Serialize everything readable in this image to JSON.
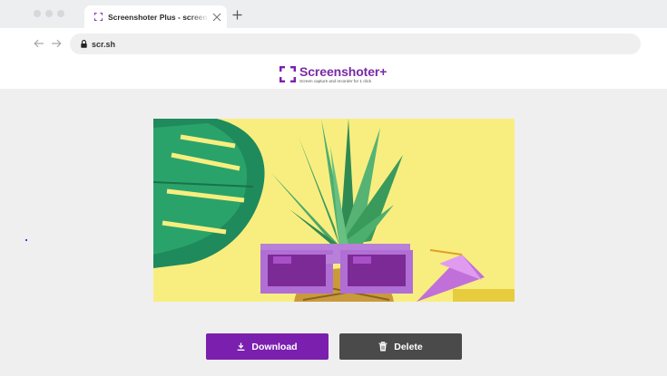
{
  "browser": {
    "tab_title": "Screenshoter Plus - screen capture",
    "url": "scr.sh"
  },
  "header": {
    "logo_name": "Screenshoter+",
    "logo_tagline": "Screen capture and recorder for 1 click"
  },
  "screenshot": {
    "description_icon": "image-preview"
  },
  "actions": {
    "download_label": "Download",
    "delete_label": "Delete"
  },
  "colors": {
    "brand": "#7b1fae",
    "delete": "#4a4a4a",
    "image_bg": "#f9ee7d"
  }
}
